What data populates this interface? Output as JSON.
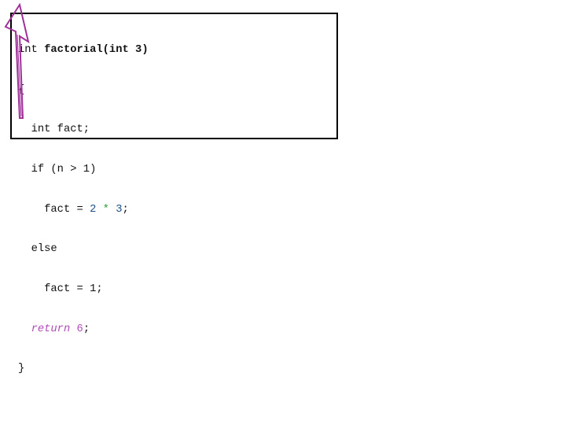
{
  "code": {
    "signature": {
      "return_type": "int",
      "function_name_and_args": "factorial(int 3)"
    },
    "open_brace": "{",
    "line_decl": "int fact;",
    "line_if": "if (n > 1)",
    "line_assign_prefix": "fact = ",
    "line_assign_left": "2",
    "line_assign_op": "*",
    "line_assign_right": "3",
    "line_assign_suffix": ";",
    "line_else": "else",
    "line_else_assign": "fact = 1;",
    "return_keyword": "return",
    "return_value": "6",
    "return_suffix": ";",
    "close_brace": "}"
  },
  "annotation": {
    "arrow_icon": "upward-arrow-icon",
    "arrow_color": "#a0309a"
  },
  "colors": {
    "number": "#1d4f8a",
    "operator": "#2e9b3a",
    "return_highlight": "#b04cb8"
  }
}
